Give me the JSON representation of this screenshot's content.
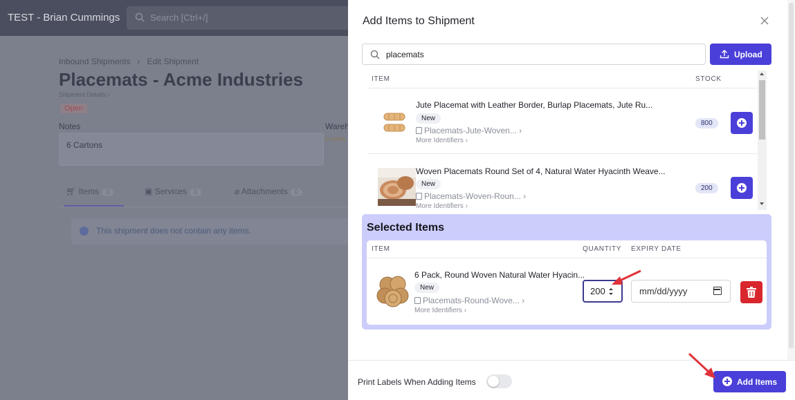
{
  "app": {
    "org_name": "TEST - Brian Cummings",
    "search_placeholder": "Search [Ctrl+/]"
  },
  "background_page": {
    "breadcrumb": [
      "Inbound Shipments",
      "Edit Shipment"
    ],
    "title": "Placemats - Acme Industries",
    "subtitle": "Shipment Details",
    "status": "Open",
    "notes_label": "Notes",
    "notes_value": "6 Cartons",
    "warehouse_label": "Warehou",
    "warehouse_note": "o notes",
    "tabs": [
      {
        "label": "Items",
        "count": "0"
      },
      {
        "label": "Services",
        "count": "0"
      },
      {
        "label": "Attachments",
        "count": "0"
      }
    ],
    "empty_message": "This shipment does not contain any items."
  },
  "drawer": {
    "title": "Add Items to Shipment",
    "search_value": "placemats",
    "upload_label": "Upload",
    "results": {
      "headers": {
        "item": "ITEM",
        "stock": "STOCK"
      },
      "rows": [
        {
          "name": "Jute Placemat with Leather Border, Burlap Placemats, Jute Ru...",
          "badge": "New",
          "sku": "Placemats-Jute-Woven...",
          "more": "More Identifiers",
          "stock": "800"
        },
        {
          "name": "Woven Placemats Round Set of 4, Natural Water Hyacinth Weave...",
          "badge": "New",
          "sku": "Placemats-Woven-Roun...",
          "more": "More Identifiers",
          "stock": "200"
        }
      ]
    },
    "selected": {
      "title": "Selected Items",
      "headers": {
        "item": "ITEM",
        "quantity": "QUANTITY",
        "expiry": "EXPIRY DATE"
      },
      "rows": [
        {
          "name": "6 Pack, Round Woven Natural Water Hyacin...",
          "badge": "New",
          "sku": "Placemats-Round-Wove...",
          "more": "More Identifiers",
          "quantity": "200",
          "expiry_placeholder": "mm/dd/yyyy"
        }
      ]
    },
    "footer": {
      "print_labels": "Print Labels When Adding Items",
      "print_labels_enabled": false,
      "add_items_label": "Add Items"
    }
  },
  "colors": {
    "primary": "#4a3fd8",
    "danger": "#d8262c",
    "selected_bg": "#cccdfb",
    "annotation_arrow": "#e0323a"
  }
}
